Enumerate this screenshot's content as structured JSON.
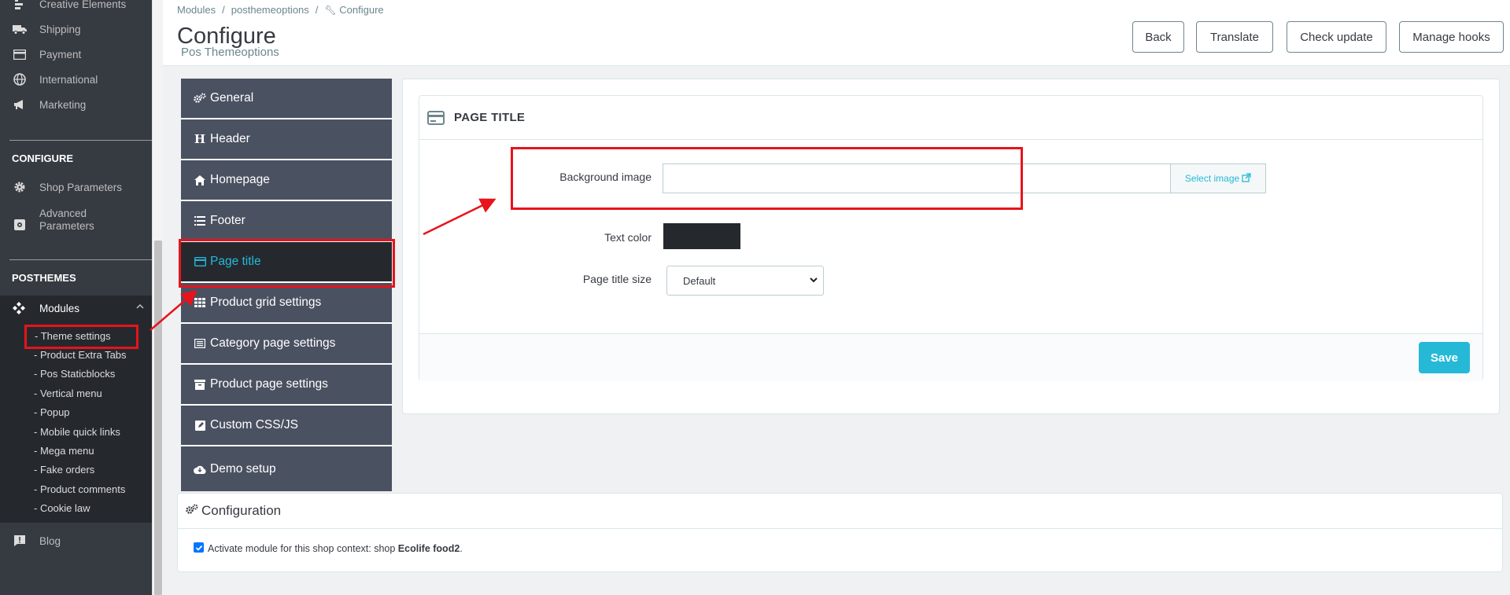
{
  "sidebar": {
    "items_top": [
      {
        "label": "Creative Elements",
        "icon": "creative-elements-icon"
      },
      {
        "label": "Shipping",
        "icon": "truck-icon"
      },
      {
        "label": "Payment",
        "icon": "credit-card-icon"
      },
      {
        "label": "International",
        "icon": "globe-icon"
      },
      {
        "label": "Marketing",
        "icon": "megaphone-icon"
      }
    ],
    "configure_title": "CONFIGURE",
    "shop_parameters": "Shop Parameters",
    "advanced_parameters_1": "Advanced",
    "advanced_parameters_2": "Parameters",
    "posthemes_title": "POSTHEMES",
    "modules": "Modules",
    "submenu": [
      "- Theme settings",
      "- Product Extra Tabs",
      "- Pos Staticblocks",
      "- Vertical menu",
      "- Popup",
      "- Mobile quick links",
      "- Mega menu",
      "- Fake orders",
      "- Product comments",
      "- Cookie law"
    ],
    "blog": "Blog"
  },
  "header": {
    "breadcrumb": [
      "Modules",
      "posthemeoptions",
      "Configure"
    ],
    "breadcrumb_sep": "/",
    "title": "Configure",
    "subtitle": "Pos Themeoptions",
    "buttons": {
      "back": "Back",
      "translate": "Translate",
      "check_update": "Check update",
      "manage_hooks": "Manage hooks"
    }
  },
  "tabs": [
    {
      "label": "General",
      "icon": "gears-icon"
    },
    {
      "label": "Header",
      "icon": "header-icon"
    },
    {
      "label": "Homepage",
      "icon": "home-icon"
    },
    {
      "label": "Footer",
      "icon": "list-icon"
    },
    {
      "label": "Page title",
      "icon": "credit-card-icon",
      "active": true
    },
    {
      "label": "Product grid settings",
      "icon": "grid-icon"
    },
    {
      "label": "Category page settings",
      "icon": "list-alt-icon"
    },
    {
      "label": "Product page settings",
      "icon": "archive-icon"
    },
    {
      "label": "Custom CSS/JS",
      "icon": "edit-icon"
    },
    {
      "label": "Demo setup",
      "icon": "cloud-download-icon"
    }
  ],
  "panel": {
    "title": "PAGE TITLE",
    "background_image_label": "Background image",
    "select_image": "Select image",
    "text_color_label": "Text color",
    "text_color_value": "#25292e",
    "page_title_size_label": "Page title size",
    "page_title_size_value": "Default",
    "save": "Save"
  },
  "configuration": {
    "title": "Configuration",
    "checkbox_label_prefix": "Activate module for this shop context: shop ",
    "shop_name": "Ecolife food2",
    "checkbox_label_suffix": ".",
    "checked": true
  },
  "colors": {
    "accent": "#25b9d7",
    "highlight": "#e8131b",
    "sidebar": "#363a41",
    "tab": "#4a5161"
  }
}
